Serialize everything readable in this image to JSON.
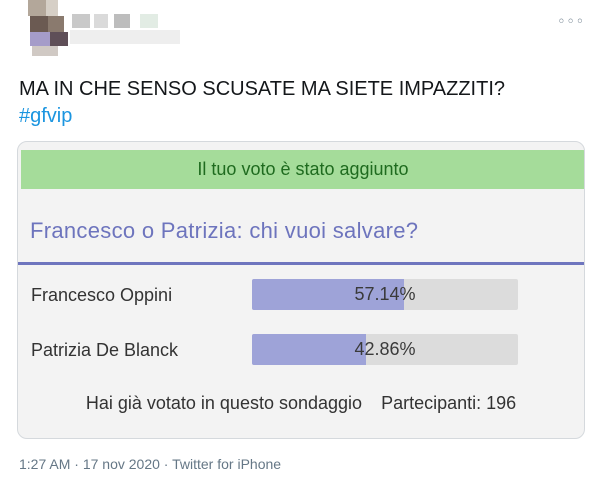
{
  "tweet": {
    "text": "MA IN CHE SENSO SCUSATE MA SIETE IMPAZZITI?",
    "hashtag": "#gfvip"
  },
  "poll": {
    "banner": "Il tuo voto è stato aggiunto",
    "title": "Francesco o Patrizia: chi vuoi salvare?",
    "options": [
      {
        "label": "Francesco Oppini",
        "percent_text": "57.14%",
        "percent": 57.14
      },
      {
        "label": "Patrizia De Blanck",
        "percent_text": "42.86%",
        "percent": 42.86
      }
    ],
    "voted_note": "Hai già votato in questo sondaggio",
    "participants": "Partecipanti: 196"
  },
  "meta": {
    "time": "1:27 AM",
    "separator": " · ",
    "date": "17 nov 2020",
    "source": "Twitter for iPhone"
  },
  "icons": {
    "more": "more-icon"
  },
  "colors": {
    "accent": "#6d74bd",
    "banner_bg": "#a5dc9a",
    "bar_fill": "#9ea3d8",
    "hashtag": "#1b95e0"
  }
}
